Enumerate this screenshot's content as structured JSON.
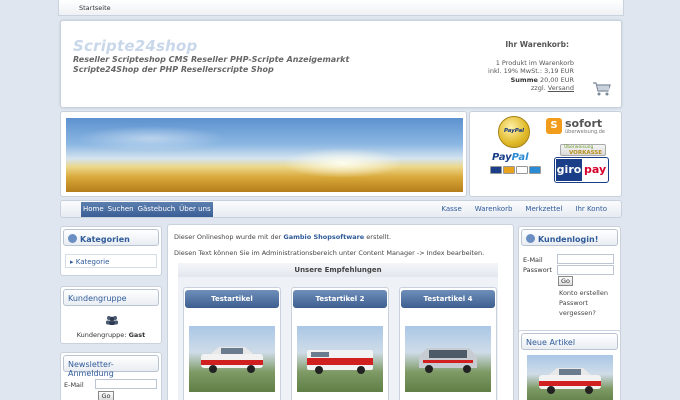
{
  "topbar": {
    "home": "Startseite"
  },
  "header": {
    "logo": "Scripte24shop",
    "tagline_1": "Reseller Scripteshop CMS Reseller PHP-Scripte Anzeigemarkt",
    "tagline_2": "Scripte24Shop der PHP Resellerscripte Shop"
  },
  "cart": {
    "title": "Ihr Warenkorb:",
    "line_1": "1 Produkt im Warenkorb",
    "line_2": "inkl. 19% MwSt.: 3,19 EUR",
    "sum_label": "Summe",
    "sum_value": " 20,00 EUR",
    "shipping_prefix": "zzgl. ",
    "shipping_link": "Versand"
  },
  "payment": {
    "paypal_seal": "PayPal",
    "paypal_logo_a": "Pay",
    "paypal_logo_b": "Pal",
    "sofort_word": "sofort",
    "sofort_sub": "überweisung.de",
    "vorkasse_top": "Überweisung",
    "vorkasse_main": "VORKASSE",
    "giro_a": "giro",
    "giro_b": "pay"
  },
  "nav": {
    "left": [
      "Home",
      "Suchen",
      "Gästebuch",
      "Über uns"
    ],
    "right": [
      "Kasse",
      "Warenkorb",
      "Merkzettel",
      "Ihr Konto"
    ]
  },
  "left": {
    "categories_title": "Kategorien",
    "category_item": "Kategorie",
    "group_title": "Kundengruppe",
    "group_label": "Kundengruppe: ",
    "group_value": "Gast",
    "newsletter_title": "Newsletter-Anmeldung",
    "email_label": "E-Mail",
    "go": "Go"
  },
  "main": {
    "intro_1a": "Dieser Onlineshop wurde mit der ",
    "intro_1b": "Gambio Shopsoftware",
    "intro_1c": " erstellt.",
    "intro_2": "Diesen Text können Sie im Administrationsbereich unter Content Manager -> Index bearbeiten.",
    "rec_title": "Unsere Empfehlungen",
    "products": [
      "Testartikel",
      "Testartikel 2",
      "Testartikel 4"
    ]
  },
  "right": {
    "login_title": "Kundenlogin!",
    "email_label": "E-Mail",
    "password_label": "Passwort",
    "go": "Go",
    "create_account": "Konto erstellen",
    "forgot": "Passwort vergessen?",
    "new_title": "Neue Artikel"
  },
  "colors": {
    "accent": "#2f5b9a",
    "nav_active": "#3a5f95",
    "background": "#dfe6ef"
  }
}
